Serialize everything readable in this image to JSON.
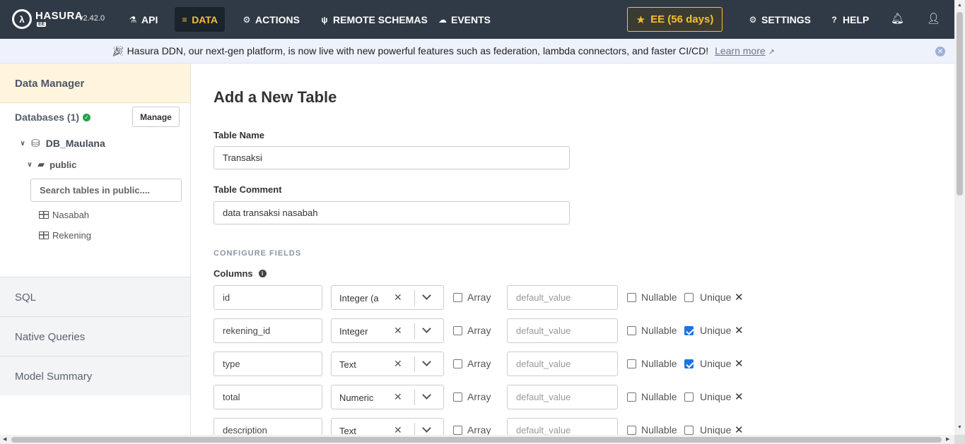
{
  "topnav": {
    "brand": "HASURA",
    "brand_badge": "EE",
    "version": "v2.42.0",
    "items": [
      {
        "label": "API",
        "icon": "flask-icon"
      },
      {
        "label": "DATA",
        "icon": "database-icon"
      },
      {
        "label": "ACTIONS",
        "icon": "cogs-icon"
      },
      {
        "label": "REMOTE SCHEMAS",
        "icon": "plug-icon"
      },
      {
        "label": "EVENTS",
        "icon": "cloud-icon"
      }
    ],
    "active_item": "DATA",
    "ee_button": "EE (56 days)",
    "settings": "SETTINGS",
    "help": "HELP"
  },
  "banner": {
    "text": "Hasura DDN, our next-gen platform, is now live with new powerful features such as federation, lambda connectors, and faster CI/CD!",
    "link": "Learn more"
  },
  "sidebar": {
    "header": "Data Manager",
    "databases_title": "Databases (1)",
    "manage_button": "Manage",
    "database": "DB_Maulana",
    "schema": "public",
    "search_placeholder": "Search tables in public....",
    "tables": [
      "Nasabah",
      "Rekening"
    ],
    "sections": [
      "SQL",
      "Native Queries",
      "Model Summary"
    ]
  },
  "main": {
    "title": "Add a New Table",
    "table_name_label": "Table Name",
    "table_name_value": "Transaksi",
    "table_comment_label": "Table Comment",
    "table_comment_value": "data transaksi nasabah",
    "configure_fields": "CONFIGURE FIELDS",
    "columns_label": "Columns",
    "array_label": "Array",
    "nullable_label": "Nullable",
    "unique_label": "Unique",
    "default_placeholder": "default_value",
    "columns": [
      {
        "name": "id",
        "type": "Integer (a",
        "array": false,
        "nullable": false,
        "unique": false
      },
      {
        "name": "rekening_id",
        "type": "Integer",
        "array": false,
        "nullable": false,
        "unique": true
      },
      {
        "name": "type",
        "type": "Text",
        "array": false,
        "nullable": false,
        "unique": true
      },
      {
        "name": "total",
        "type": "Numeric",
        "array": false,
        "nullable": false,
        "unique": false
      },
      {
        "name": "description",
        "type": "Text",
        "array": false,
        "nullable": false,
        "unique": false
      }
    ]
  }
}
